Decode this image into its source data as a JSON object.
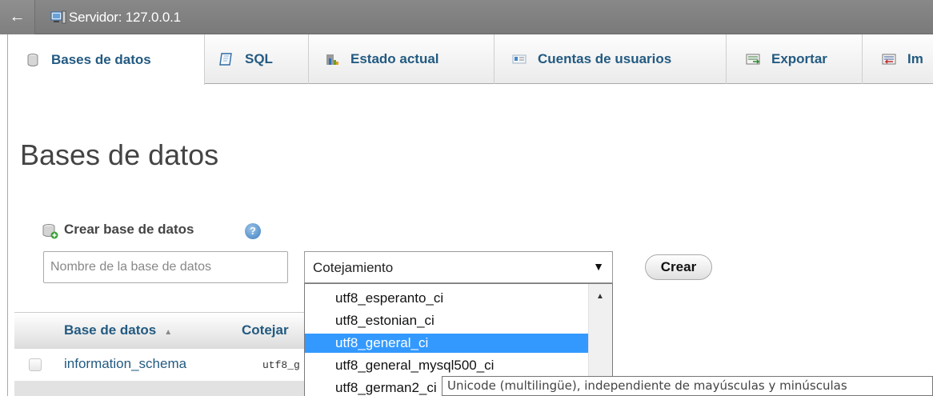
{
  "server": {
    "back_glyph": "←",
    "label": "Servidor: 127.0.0.1",
    "icon": "server-icon"
  },
  "tabs": [
    {
      "label": "Bases de datos",
      "icon": "database-icon",
      "active": true
    },
    {
      "label": "SQL",
      "icon": "sql-page-icon"
    },
    {
      "label": "Estado actual",
      "icon": "status-chart-icon"
    },
    {
      "label": "Cuentas de usuarios",
      "icon": "user-accounts-icon"
    },
    {
      "label": "Exportar",
      "icon": "export-icon"
    },
    {
      "label": "Im",
      "icon": "import-icon"
    }
  ],
  "page": {
    "title": "Bases de datos"
  },
  "create": {
    "label": "Crear base de datos",
    "help": "?",
    "name_placeholder": "Nombre de la base de datos",
    "name_value": "",
    "collation_selected": "Cotejamiento",
    "select_arrow": "▼",
    "button": "Crear"
  },
  "table": {
    "headers": [
      "Base de datos",
      "Cotejar"
    ],
    "sort_glyph": "▲",
    "rows": [
      {
        "name": "information_schema",
        "collation": "utf8_g"
      }
    ]
  },
  "dropdown": {
    "scroll_up": "▲",
    "items": [
      {
        "label": "utf8_esperanto_ci",
        "selected": false
      },
      {
        "label": "utf8_estonian_ci",
        "selected": false
      },
      {
        "label": "utf8_general_ci",
        "selected": true
      },
      {
        "label": "utf8_general_mysql500_ci",
        "selected": false
      },
      {
        "label": "utf8_german2_ci",
        "selected": false
      }
    ]
  },
  "tooltip": {
    "text": "Unicode (multilingüe), independiente de mayúsculas y minúsculas"
  },
  "colors": {
    "selected": "#3399ff",
    "link": "#235a81",
    "server_bar": "#888888"
  }
}
